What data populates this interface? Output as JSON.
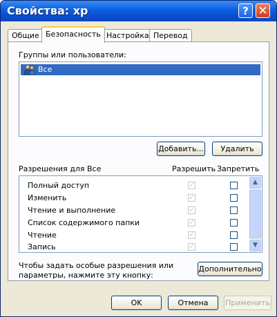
{
  "window": {
    "title": "Свойства: xp",
    "help_glyph": "?",
    "close_glyph": "✕"
  },
  "tabs": [
    {
      "label": "Общие"
    },
    {
      "label": "Безопасность",
      "active": true
    },
    {
      "label": "Настройка"
    },
    {
      "label": "Перевод"
    }
  ],
  "groups": {
    "label": "Группы или пользователи:",
    "items": [
      {
        "label": "Все",
        "selected": true,
        "icon": "users-group-icon"
      }
    ]
  },
  "buttons": {
    "add": "Добавить...",
    "remove": "Удалить",
    "advanced": "Дополнительно",
    "ok": "OK",
    "cancel": "Отмена",
    "apply": "Применить"
  },
  "permissions": {
    "label": "Разрешения для Все",
    "col_allow": "Разрешить",
    "col_deny": "Запретить",
    "rows": [
      {
        "name": "Полный доступ",
        "allow": true,
        "deny": false
      },
      {
        "name": "Изменить",
        "allow": true,
        "deny": false
      },
      {
        "name": "Чтение и выполнение",
        "allow": true,
        "deny": false
      },
      {
        "name": "Список содержимого папки",
        "allow": true,
        "deny": false
      },
      {
        "name": "Чтение",
        "allow": true,
        "deny": false
      },
      {
        "name": "Запись",
        "allow": true,
        "deny": false
      }
    ]
  },
  "advanced_hint": {
    "line1": "Чтобы задать особые разрешения или",
    "line2": "параметры, нажмите эту кнопку:"
  },
  "colors": {
    "titlebar": "#0a4fd1",
    "selection": "#316ac5",
    "tab_highlight": "#ffc83c"
  }
}
